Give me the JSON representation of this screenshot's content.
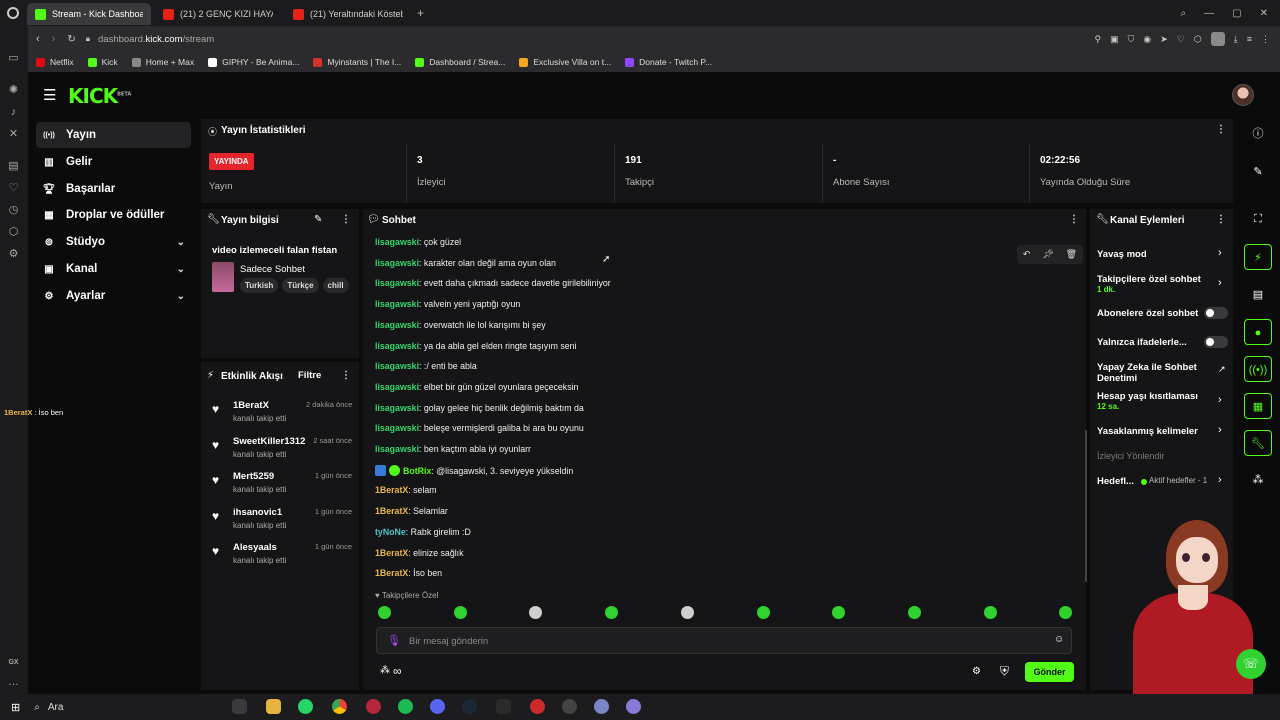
{
  "browser": {
    "tabs": [
      {
        "label": "Stream - Kick Dashboard",
        "color": "#53fc18",
        "active": true
      },
      {
        "label": "(21) 2 GENÇ KIZI HAYATT",
        "color": "#e62117",
        "active": false
      },
      {
        "label": "(21) Yeraltındaki Köstebek",
        "color": "#e62117",
        "active": false
      }
    ],
    "url_prefix": "dashboard.",
    "url_host": "kick.com",
    "url_path": "/stream",
    "bookmarks": [
      {
        "label": "Netflix",
        "color": "#e50914"
      },
      {
        "label": "Kick",
        "color": "#53fc18"
      },
      {
        "label": "Home + Max",
        "color": "#888888"
      },
      {
        "label": "GIPHY - Be Anima...",
        "color": "#ffffff"
      },
      {
        "label": "Myinstants | The I...",
        "color": "#d0342c"
      },
      {
        "label": "Dashboard / Strea...",
        "color": "#53fc18"
      },
      {
        "label": "Exclusive Villa on t...",
        "color": "#f5a623"
      },
      {
        "label": "Donate - Twitch P...",
        "color": "#9146ff"
      }
    ]
  },
  "brand": {
    "logo": "KICK",
    "badge": "BETA",
    "accent": "#53fc18"
  },
  "nav": [
    {
      "label": "Yayın",
      "icon": "broadcast-icon",
      "active": true,
      "expandable": false
    },
    {
      "label": "Gelir",
      "icon": "revenue-icon",
      "active": false,
      "expandable": false
    },
    {
      "label": "Başarılar",
      "icon": "trophy-icon",
      "active": false,
      "expandable": false
    },
    {
      "label": "Droplar ve ödüller",
      "icon": "drops-icon",
      "active": false,
      "expandable": false
    },
    {
      "label": "Stüdyo",
      "icon": "studio-icon",
      "active": false,
      "expandable": true
    },
    {
      "label": "Kanal",
      "icon": "channel-icon",
      "active": false,
      "expandable": true
    },
    {
      "label": "Ayarlar",
      "icon": "settings-icon",
      "active": false,
      "expandable": true
    }
  ],
  "stats": {
    "title": "Yayın İstatistikleri",
    "live_badge": "YAYINDA",
    "live_label": "Yayın",
    "items": [
      {
        "value": "3",
        "label": "İzleyici"
      },
      {
        "value": "191",
        "label": "Takipçi"
      },
      {
        "value": "-",
        "label": "Abone Sayısı"
      },
      {
        "value": "02:22:56",
        "label": "Yayında Olduğu Süre"
      }
    ]
  },
  "stream_info": {
    "title": "Yayın bilgisi",
    "stream_title": "video izlemeceli falan fistan",
    "category": "Sadece Sohbet",
    "tags": [
      "Turkish",
      "Türkçe",
      "chill"
    ]
  },
  "activity": {
    "title": "Etkinlik Akışı",
    "filter_label": "Filtre",
    "events": [
      {
        "name": "1BeratX",
        "action": "kanalı takip etti",
        "time": "2 dakika önce"
      },
      {
        "name": "SweetKiller1312",
        "action": "kanalı takip etti",
        "time": "2 saat önce"
      },
      {
        "name": "Mert5259",
        "action": "kanalı takip etti",
        "time": "1 gün önce"
      },
      {
        "name": "ihsanovic1",
        "action": "kanalı takip etti",
        "time": "1 gün önce"
      },
      {
        "name": "Alesyaals",
        "action": "kanalı takip etti",
        "time": "1 gün önce"
      }
    ]
  },
  "chat": {
    "title": "Sohbet",
    "messages": [
      {
        "user": "lisagawski",
        "text": ": çok güzel",
        "color": "#36d66b"
      },
      {
        "user": "lisagawski",
        "text": ": karakter olan değil ama oyun olan",
        "color": "#36d66b"
      },
      {
        "user": "lisagawski",
        "text": ": evett daha çıkmadı sadece davetle girilebiliniyor",
        "color": "#36d66b"
      },
      {
        "user": "lisagawski",
        "text": ": valvein yeni yaptığı oyun",
        "color": "#36d66b"
      },
      {
        "user": "lisagawski",
        "text": ": overwatch ile lol karışımı bi şey",
        "color": "#36d66b"
      },
      {
        "user": "lisagawski",
        "text": ": ya da abla gel elden ringte taşıyım seni",
        "color": "#36d66b"
      },
      {
        "user": "lisagawski",
        "text": ": :/ enti be abla",
        "color": "#36d66b"
      },
      {
        "user": "lisagawski",
        "text": ": elbet bir gün güzel oyunlara geçeceksin",
        "color": "#36d66b"
      },
      {
        "user": "lisagawski",
        "text": ": golay gelee hiç benlik değilmiş baktım da",
        "color": "#36d66b"
      },
      {
        "user": "lisagawski",
        "text": ": beleşe vermişlerdi galiba bi ara bu oyunu",
        "color": "#36d66b"
      },
      {
        "user": "lisagawski",
        "text": ": ben kaçtım abla iyi oyunlarr",
        "color": "#36d66b"
      },
      {
        "user": "BotRix",
        "text": ": @lisagawski, 3. seviyeye yükseldin",
        "color": "#53fc18"
      },
      {
        "user": "1BeratX",
        "text": ": selam",
        "color": "#e8b84a"
      },
      {
        "user": "1BeratX",
        "text": ": Selamlar",
        "color": "#e8b84a"
      },
      {
        "user": "tyNoNe",
        "text": ": Rabk girelim :D",
        "color": "#46c2c8"
      },
      {
        "user": "1BeratX",
        "text": ": elinize sağlık",
        "color": "#e8b84a"
      },
      {
        "user": "1BeratX",
        "text": ": İso ben",
        "color": "#e8b84a"
      }
    ],
    "followers_only_label": "Takipçilere Özel",
    "input_placeholder": "Bir mesaj gönderin",
    "send_label": "Gönder",
    "points": "∞"
  },
  "channel_actions": {
    "title": "Kanal Eylemleri",
    "items": [
      {
        "label": "Yavaş mod",
        "sub": "",
        "control": "arrow"
      },
      {
        "label": "Takipçilere özel sohbet",
        "sub": "1 dk.",
        "control": "arrow"
      },
      {
        "label": "Abonelere özel sohbet",
        "sub": "",
        "control": "toggle"
      },
      {
        "label": "Yalnızca ifadelerle...",
        "sub": "",
        "control": "toggle"
      },
      {
        "label": "Yapay Zeka ile Sohbet Denetimi",
        "sub": "",
        "control": "external"
      },
      {
        "label": "Hesap yaşı kısıtlaması",
        "sub": "12 sa.",
        "control": "arrow"
      },
      {
        "label": "Yasaklanmış kelimeler",
        "sub": "",
        "control": "arrow"
      }
    ],
    "raid_label": "İzleyici Yönlendir",
    "goals_label": "Hedefl...",
    "goals_status": "Aktif hedefler - 1"
  },
  "overlay_caption": {
    "user": "1BeratX",
    "text": "İso ben"
  },
  "taskbar": {
    "search_label": "Ara"
  },
  "sidebar_extra": {
    "gx_label": "GX"
  }
}
